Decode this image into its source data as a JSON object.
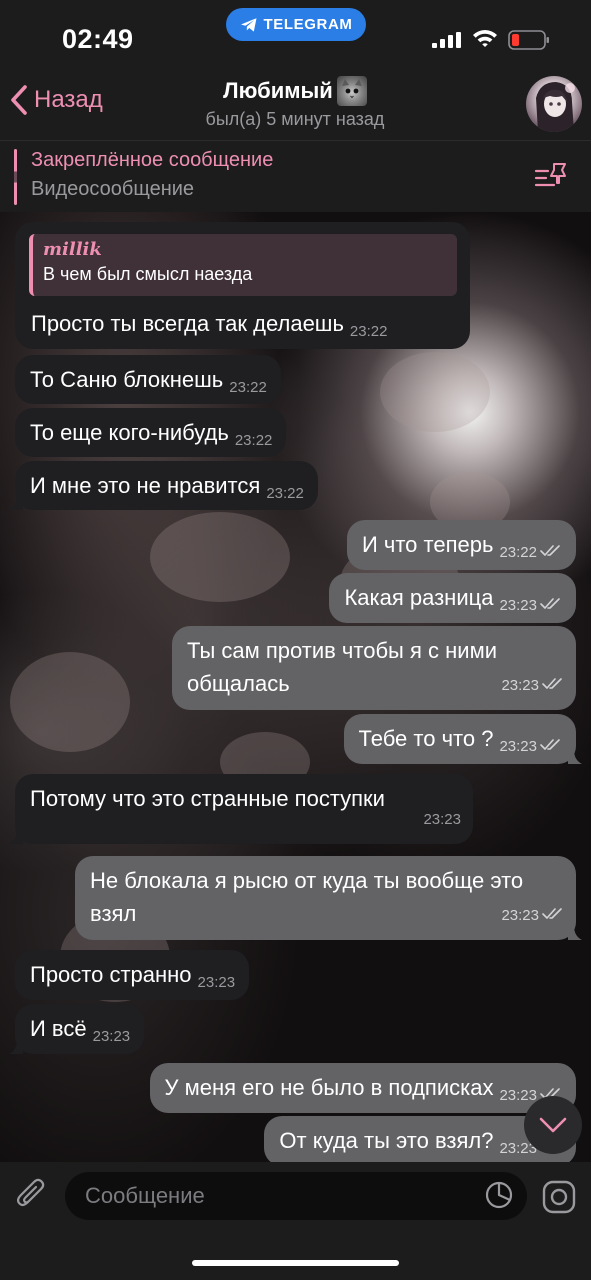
{
  "status_bar": {
    "time": "02:49",
    "app_pill": "TELEGRAM"
  },
  "header": {
    "back_label": "Назад",
    "title": "Любимый",
    "status": "был(а) 5 минут назад"
  },
  "pinned": {
    "title": "Закреплённое сообщение",
    "text": "Видеосообщение"
  },
  "reply": {
    "name": "millik",
    "text": "В чем был смысл наезда"
  },
  "messages": [
    {
      "dir": "in",
      "text": "Просто ты всегда так делаешь",
      "time": "23:22"
    },
    {
      "dir": "in",
      "text": "То Саню блокнешь",
      "time": "23:22"
    },
    {
      "dir": "in",
      "text": "То еще кого-нибудь",
      "time": "23:22"
    },
    {
      "dir": "in",
      "text": "И мне это не нравится",
      "time": "23:22"
    },
    {
      "dir": "out",
      "text": "И что теперь",
      "time": "23:22"
    },
    {
      "dir": "out",
      "text": "Какая разница",
      "time": "23:23"
    },
    {
      "dir": "out",
      "text": "Ты сам против чтобы я с ними общалась",
      "time": "23:23"
    },
    {
      "dir": "out",
      "text": "Тебе то что ?",
      "time": "23:23"
    },
    {
      "dir": "in",
      "text": "Потому что это странные поступки",
      "time": "23:23"
    },
    {
      "dir": "out",
      "text": "Не блокала я рысю от куда ты вообще это взял",
      "time": "23:23"
    },
    {
      "dir": "in",
      "text": "Просто странно",
      "time": "23:23"
    },
    {
      "dir": "in",
      "text": "И всё",
      "time": "23:23"
    },
    {
      "dir": "out",
      "text": "У меня его не было в подписках",
      "time": "23:23"
    },
    {
      "dir": "out",
      "text": "От куда ты это взял?",
      "time": "23:23"
    }
  ],
  "input": {
    "placeholder": "Сообщение"
  },
  "colors": {
    "accent": "#ee8fb1",
    "outgoing_bubble": "#636366",
    "incoming_bubble": "#1f1f22",
    "telegram_pill": "#2a7ee6"
  },
  "icons": [
    "telegram-icon",
    "signal-icon",
    "wifi-icon",
    "battery-icon",
    "back-chevron-icon",
    "pinned-list-icon",
    "read-checks-icon",
    "chevron-down-icon",
    "paperclip-icon",
    "sticker-icon",
    "camera-icon"
  ]
}
